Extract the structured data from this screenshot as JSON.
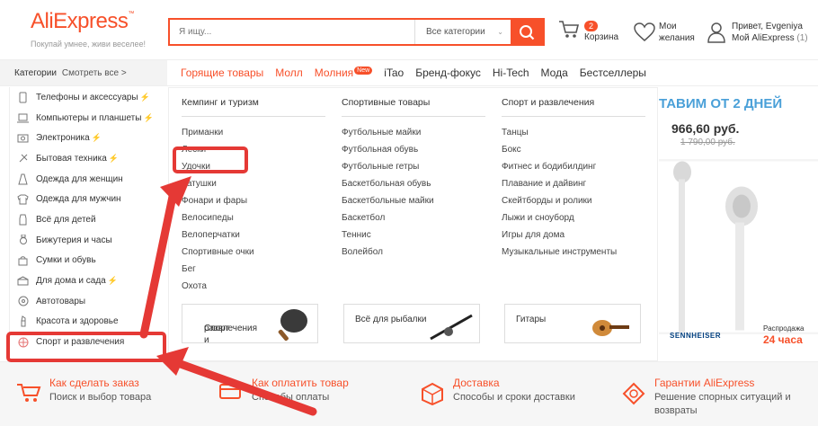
{
  "header": {
    "logo": "AliExpress",
    "logo_mark": "™",
    "tagline": "Покупай умнее, живи веселее!",
    "search_placeholder": "Я ищу...",
    "search_category": "Все категории",
    "cart_count": "2",
    "cart_label": "Корзина",
    "wishlist_line1": "Мои",
    "wishlist_line2": "желания",
    "user_line1": "Привет, Evgeniya",
    "user_line2": "Мой AliExpress",
    "user_count": "(1)"
  },
  "nav": {
    "categories": "Категории",
    "see_all": "Смотреть все >",
    "links": [
      "Горящие товары",
      "Молл",
      "Молния",
      "iTao",
      "Бренд-фокус",
      "Hi-Tech",
      "Мода",
      "Бестселлеры"
    ],
    "new_badge": "New"
  },
  "sidebar": {
    "items": [
      "Телефоны и аксессуары",
      "Компьютеры и планшеты",
      "Электроника",
      "Бытовая техника",
      "Одежда для женщин",
      "Одежда для мужчин",
      "Всё для детей",
      "Бижутерия и часы",
      "Сумки и обувь",
      "Для дома и сада",
      "Автотовары",
      "Красота и здоровье",
      "Спорт и развлечения"
    ],
    "bolt": "⚡"
  },
  "mega": {
    "col1": {
      "title": "Кемпинг и туризм",
      "items": [
        "Приманки",
        "Лески",
        "Удочки",
        "Катушки",
        "Фонари и фары",
        "Велосипеды",
        "Велоперчатки",
        "Спортивные очки",
        "Бег",
        "Охота"
      ]
    },
    "col2": {
      "title": "Спортивные товары",
      "items": [
        "Футбольные майки",
        "Футбольная обувь",
        "Футбольные гетры",
        "Баскетбольная обувь",
        "Баскетбольные майки",
        "Баскетбол",
        "Теннис",
        "Волейбол"
      ]
    },
    "col3": {
      "title": "Спорт и развлечения",
      "items": [
        "Танцы",
        "Бокс",
        "Фитнес и бодибилдинг",
        "Плавание и дайвинг",
        "Скейтборды и ролики",
        "Лыжи и сноуборд",
        "Игры для дома",
        "Музыкальные инструменты"
      ]
    },
    "promo1_line1": "Спорт и",
    "promo1_line2": "развлечения",
    "promo2": "Всё для рыбалки",
    "promo3": "Гитары"
  },
  "banner": {
    "title": "ТАВИМ ОТ 2 ДНЕЙ",
    "price": "966,60 руб.",
    "old_price": "1 790,00 руб.",
    "brand": "SENNHEISER",
    "sale_label": "Распродажа",
    "sale_time": "24 часа"
  },
  "footer": {
    "f1_title": "Как сделать заказ",
    "f1_sub": "Поиск и выбор товара",
    "f2_title": "Как оплатить товар",
    "f2_sub": "Способы оплаты",
    "f3_title": "Доставка",
    "f3_sub": "Способы и сроки доставки",
    "f4_title": "Гарантии AliExpress",
    "f4_sub1": "Решение спорных ситуаций и",
    "f4_sub2": "возвраты"
  },
  "colors": {
    "accent": "#f7502a",
    "annotation": "#e53935"
  }
}
